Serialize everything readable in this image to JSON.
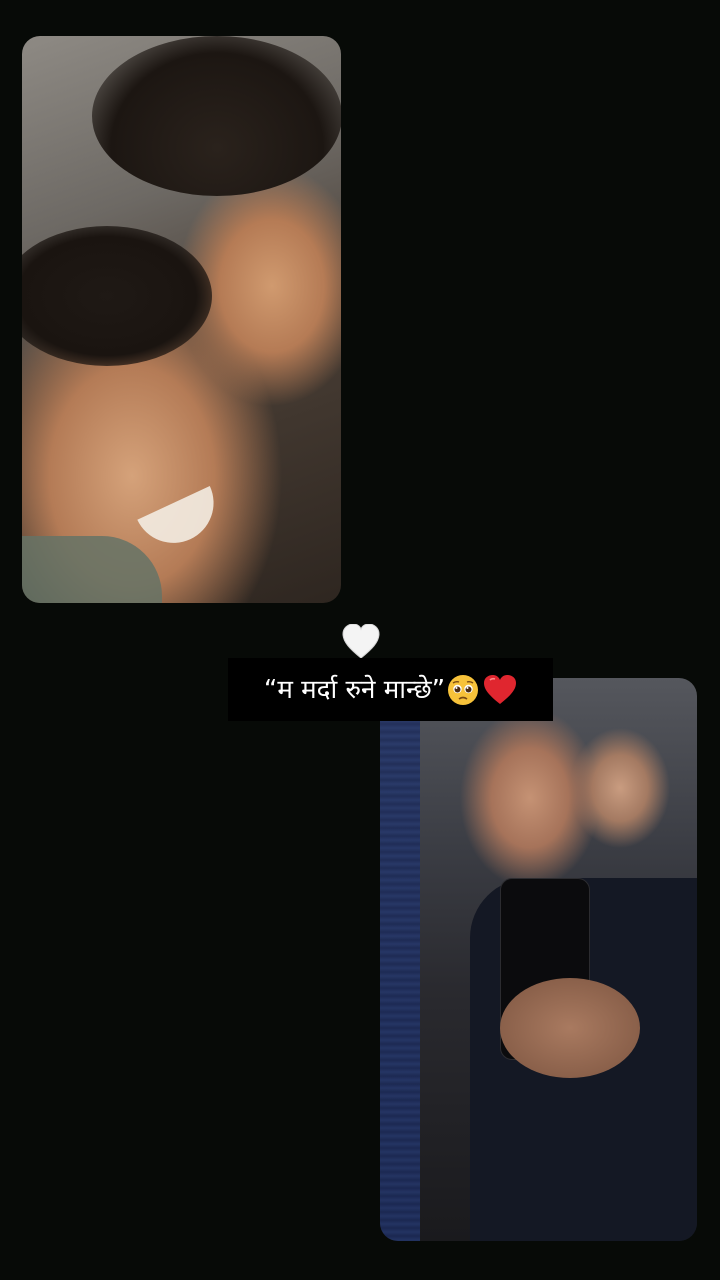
{
  "caption": {
    "text": "“म मर्दा रुने मान्छे”"
  },
  "icons": {
    "top_heart": "white-heart-icon",
    "pleading_face": "pleading-face-emoji",
    "red_heart": "red-heart-emoji"
  },
  "photos": [
    {
      "name": "photo-top-left"
    },
    {
      "name": "photo-bottom-right"
    }
  ],
  "colors": {
    "background": "#070a07",
    "caption_bg": "#000000",
    "caption_text": "#ffffff",
    "heart_red": "#e0262f",
    "heart_white": "#f4f4f4"
  }
}
